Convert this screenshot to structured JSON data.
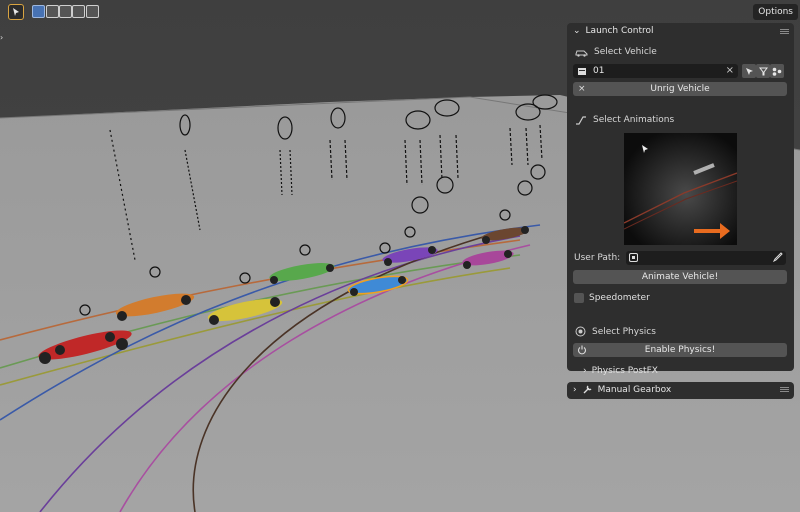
{
  "header": {
    "options_label": "Options",
    "icons": [
      "select-box-icon",
      "mode-new-icon",
      "mode-extend-icon",
      "mode-subtract-icon",
      "mode-intersect-icon",
      "mode-invert-icon"
    ]
  },
  "panel": {
    "title": "Launch Control",
    "select_vehicle": {
      "label": "Select Vehicle",
      "value": "01"
    },
    "unrig_label": "Unrig Vehicle",
    "select_animations": {
      "label": "Select Animations"
    },
    "user_path_label": "User Path:",
    "animate_label": "Animate Vehicle!",
    "speedometer_label": "Speedometer",
    "select_physics": {
      "label": "Select Physics"
    },
    "enable_physics_label": "Enable Physics!",
    "physics_postfx_label": "Physics PostFX"
  },
  "manual_gearbox": {
    "title": "Manual Gearbox"
  },
  "colors": {
    "accent": "#4772b3",
    "panel_bg": "#2e2e2e",
    "button_bg": "#545454",
    "active_outline": "#d9a441"
  }
}
